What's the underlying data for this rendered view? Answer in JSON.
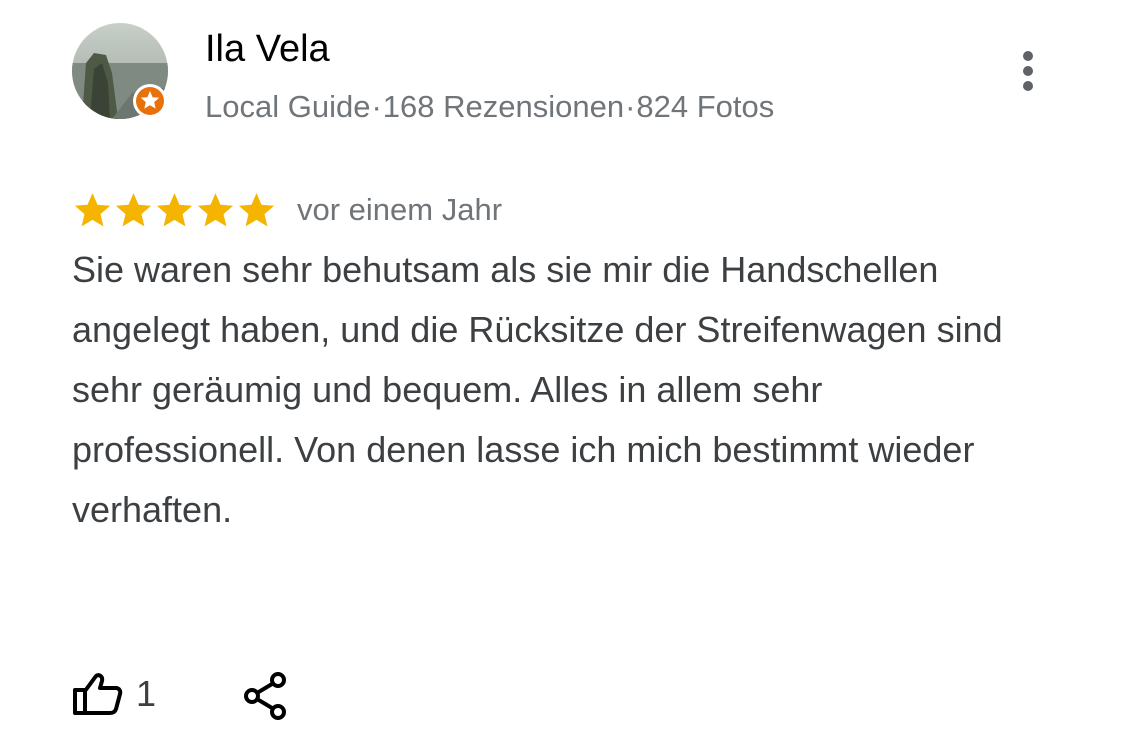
{
  "author": {
    "name": "Ila Vela",
    "level": "Local Guide",
    "separator": "·",
    "reviews": "168 Rezensionen",
    "photos": "824 Fotos"
  },
  "review": {
    "rating": 5,
    "rating_max": 5,
    "date": "vor einem Jahr",
    "text": "Sie waren sehr behutsam als sie mir die Handschellen angelegt haben, und die Rücksitze der Streifenwagen sind sehr geräumig und bequem. Alles in allem sehr professionell. Von denen lasse ich mich bestimmt wieder verhaften."
  },
  "actions": {
    "like_count": "1",
    "like_icon": "thumbs-up-icon",
    "share_icon": "share-icon",
    "more_icon": "more-vert-icon"
  },
  "colors": {
    "star": "#f4b400",
    "meta_text": "#70757a",
    "body_text": "#3c4043",
    "guide_badge": "#e8710a"
  }
}
